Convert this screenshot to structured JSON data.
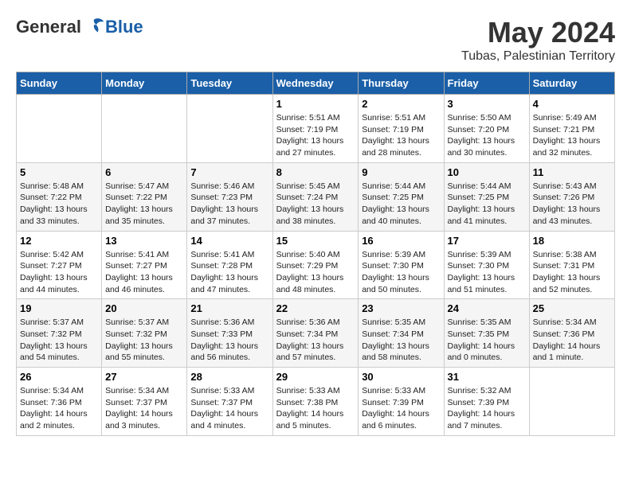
{
  "header": {
    "logo_general": "General",
    "logo_blue": "Blue",
    "month_title": "May 2024",
    "location": "Tubas, Palestinian Territory"
  },
  "days_of_week": [
    "Sunday",
    "Monday",
    "Tuesday",
    "Wednesday",
    "Thursday",
    "Friday",
    "Saturday"
  ],
  "weeks": [
    [
      {
        "day": "",
        "info": ""
      },
      {
        "day": "",
        "info": ""
      },
      {
        "day": "",
        "info": ""
      },
      {
        "day": "1",
        "info": "Sunrise: 5:51 AM\nSunset: 7:19 PM\nDaylight: 13 hours\nand 27 minutes."
      },
      {
        "day": "2",
        "info": "Sunrise: 5:51 AM\nSunset: 7:19 PM\nDaylight: 13 hours\nand 28 minutes."
      },
      {
        "day": "3",
        "info": "Sunrise: 5:50 AM\nSunset: 7:20 PM\nDaylight: 13 hours\nand 30 minutes."
      },
      {
        "day": "4",
        "info": "Sunrise: 5:49 AM\nSunset: 7:21 PM\nDaylight: 13 hours\nand 32 minutes."
      }
    ],
    [
      {
        "day": "5",
        "info": "Sunrise: 5:48 AM\nSunset: 7:22 PM\nDaylight: 13 hours\nand 33 minutes."
      },
      {
        "day": "6",
        "info": "Sunrise: 5:47 AM\nSunset: 7:22 PM\nDaylight: 13 hours\nand 35 minutes."
      },
      {
        "day": "7",
        "info": "Sunrise: 5:46 AM\nSunset: 7:23 PM\nDaylight: 13 hours\nand 37 minutes."
      },
      {
        "day": "8",
        "info": "Sunrise: 5:45 AM\nSunset: 7:24 PM\nDaylight: 13 hours\nand 38 minutes."
      },
      {
        "day": "9",
        "info": "Sunrise: 5:44 AM\nSunset: 7:25 PM\nDaylight: 13 hours\nand 40 minutes."
      },
      {
        "day": "10",
        "info": "Sunrise: 5:44 AM\nSunset: 7:25 PM\nDaylight: 13 hours\nand 41 minutes."
      },
      {
        "day": "11",
        "info": "Sunrise: 5:43 AM\nSunset: 7:26 PM\nDaylight: 13 hours\nand 43 minutes."
      }
    ],
    [
      {
        "day": "12",
        "info": "Sunrise: 5:42 AM\nSunset: 7:27 PM\nDaylight: 13 hours\nand 44 minutes."
      },
      {
        "day": "13",
        "info": "Sunrise: 5:41 AM\nSunset: 7:27 PM\nDaylight: 13 hours\nand 46 minutes."
      },
      {
        "day": "14",
        "info": "Sunrise: 5:41 AM\nSunset: 7:28 PM\nDaylight: 13 hours\nand 47 minutes."
      },
      {
        "day": "15",
        "info": "Sunrise: 5:40 AM\nSunset: 7:29 PM\nDaylight: 13 hours\nand 48 minutes."
      },
      {
        "day": "16",
        "info": "Sunrise: 5:39 AM\nSunset: 7:30 PM\nDaylight: 13 hours\nand 50 minutes."
      },
      {
        "day": "17",
        "info": "Sunrise: 5:39 AM\nSunset: 7:30 PM\nDaylight: 13 hours\nand 51 minutes."
      },
      {
        "day": "18",
        "info": "Sunrise: 5:38 AM\nSunset: 7:31 PM\nDaylight: 13 hours\nand 52 minutes."
      }
    ],
    [
      {
        "day": "19",
        "info": "Sunrise: 5:37 AM\nSunset: 7:32 PM\nDaylight: 13 hours\nand 54 minutes."
      },
      {
        "day": "20",
        "info": "Sunrise: 5:37 AM\nSunset: 7:32 PM\nDaylight: 13 hours\nand 55 minutes."
      },
      {
        "day": "21",
        "info": "Sunrise: 5:36 AM\nSunset: 7:33 PM\nDaylight: 13 hours\nand 56 minutes."
      },
      {
        "day": "22",
        "info": "Sunrise: 5:36 AM\nSunset: 7:34 PM\nDaylight: 13 hours\nand 57 minutes."
      },
      {
        "day": "23",
        "info": "Sunrise: 5:35 AM\nSunset: 7:34 PM\nDaylight: 13 hours\nand 58 minutes."
      },
      {
        "day": "24",
        "info": "Sunrise: 5:35 AM\nSunset: 7:35 PM\nDaylight: 14 hours\nand 0 minutes."
      },
      {
        "day": "25",
        "info": "Sunrise: 5:34 AM\nSunset: 7:36 PM\nDaylight: 14 hours\nand 1 minute."
      }
    ],
    [
      {
        "day": "26",
        "info": "Sunrise: 5:34 AM\nSunset: 7:36 PM\nDaylight: 14 hours\nand 2 minutes."
      },
      {
        "day": "27",
        "info": "Sunrise: 5:34 AM\nSunset: 7:37 PM\nDaylight: 14 hours\nand 3 minutes."
      },
      {
        "day": "28",
        "info": "Sunrise: 5:33 AM\nSunset: 7:37 PM\nDaylight: 14 hours\nand 4 minutes."
      },
      {
        "day": "29",
        "info": "Sunrise: 5:33 AM\nSunset: 7:38 PM\nDaylight: 14 hours\nand 5 minutes."
      },
      {
        "day": "30",
        "info": "Sunrise: 5:33 AM\nSunset: 7:39 PM\nDaylight: 14 hours\nand 6 minutes."
      },
      {
        "day": "31",
        "info": "Sunrise: 5:32 AM\nSunset: 7:39 PM\nDaylight: 14 hours\nand 7 minutes."
      },
      {
        "day": "",
        "info": ""
      }
    ]
  ]
}
